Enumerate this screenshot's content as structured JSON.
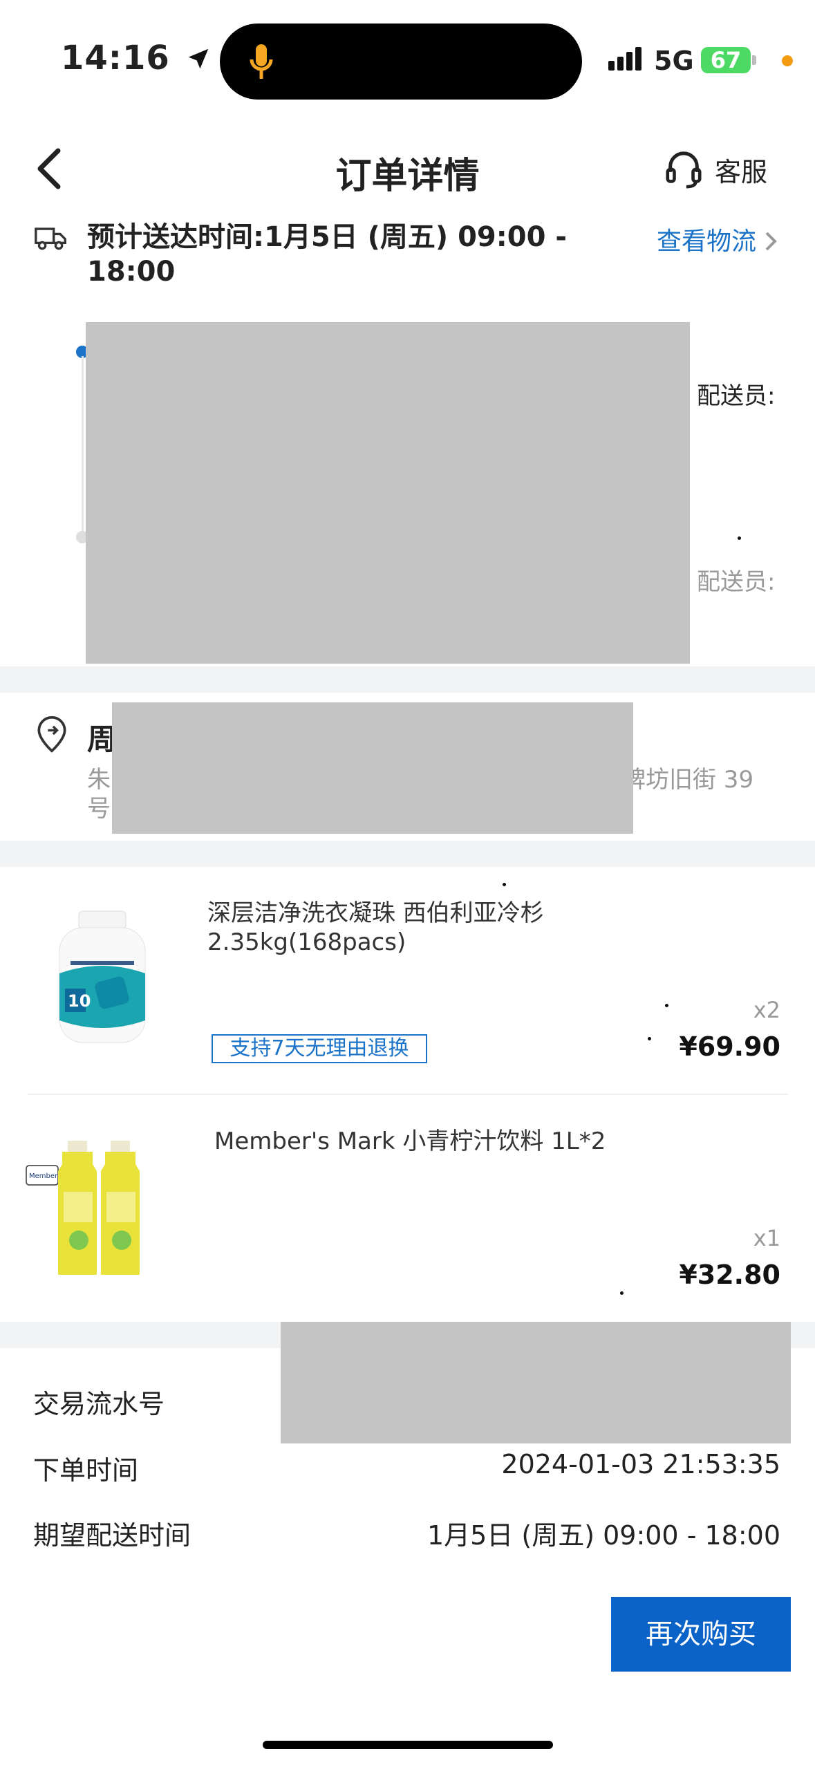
{
  "status_bar": {
    "time": "14:16",
    "network": "5G",
    "battery": "67"
  },
  "nav": {
    "title": "订单详情",
    "service_label": "客服"
  },
  "delivery": {
    "eta": "预计送达时间:1月5日 (周五) 09:00 - 18:00",
    "logistics_link": "查看物流",
    "courier_label_1": "配送员:",
    "courier_label_2": "配送员:"
  },
  "address": {
    "name_partial": "周",
    "line_prefix": "朱",
    "line_suffix": "牌坊旧街 39",
    "line2": "号"
  },
  "products": [
    {
      "name": "深层洁净洗衣凝珠 西伯利亚冷杉 2.35kg(168pacs)",
      "tag": "支持7天无理由退换",
      "qty": "x2",
      "price": "¥69.90"
    },
    {
      "name": "Member's Mark 小青柠汁饮料 1L*2",
      "qty": "x1",
      "price": "¥32.80"
    }
  ],
  "order_info": {
    "serial_label": "交易流水号",
    "order_time_label": "下单时间",
    "order_time_value": "2024-01-03 21:53:35",
    "expected_label": "期望配送时间",
    "expected_value": "1月5日 (周五) 09:00 - 18:00"
  },
  "actions": {
    "buy_again": "再次购买"
  },
  "colors": {
    "accent": "#0b63c7",
    "link": "#1a73c8",
    "section_gap": "#f2f3f5",
    "redaction": "#c4c4c4"
  }
}
